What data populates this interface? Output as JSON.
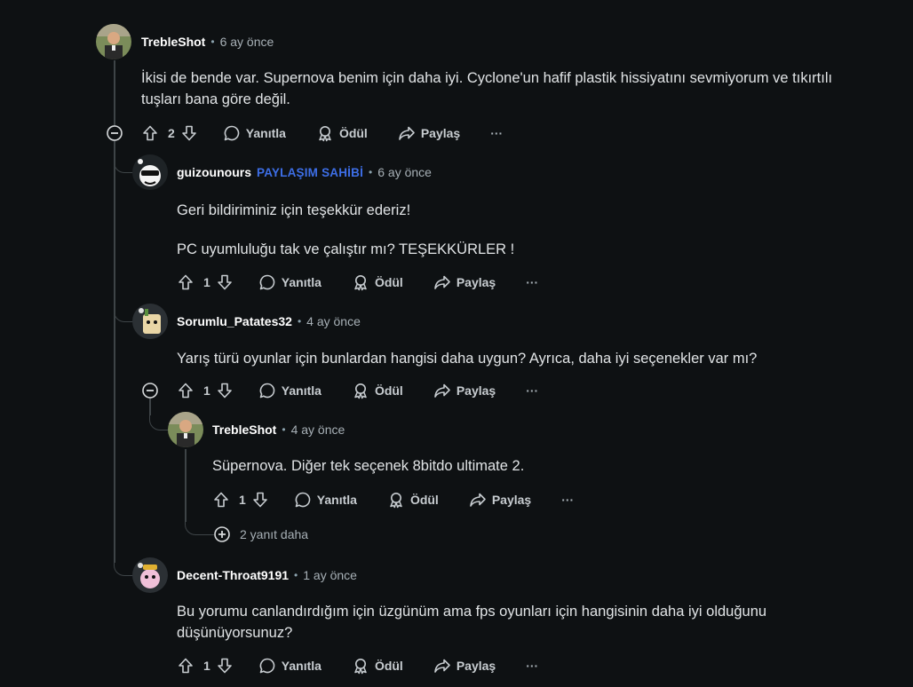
{
  "colors": {
    "background": "#0e1113",
    "op_badge": "#3d6ee6",
    "thread_line": "#3e4447",
    "text": "#e1e4e6"
  },
  "actions": {
    "reply": "Yanıtla",
    "award": "Ödül",
    "share": "Paylaş",
    "more": "···"
  },
  "comments": [
    {
      "user": "TrebleShot",
      "dot": "•",
      "time": "6 ay önce",
      "lines": [
        "İkisi de bende var. Supernova benim için daha iyi. Cyclone'un hafif plastik hissiyatını sevmiyorum ve tıkırtılı",
        "tuşları bana göre değil."
      ],
      "votes": "2"
    },
    {
      "user": "guizounours",
      "badge": "PAYLAŞIM SAHİBİ",
      "dot": "•",
      "time": "6 ay önce",
      "lines": [
        "Geri bildiriminiz için teşekkür ederiz!",
        "PC uyumluluğu tak ve çalıştır mı? TEŞEKKÜRLER !"
      ],
      "votes": "1"
    },
    {
      "user": "Sorumlu_Patates32",
      "dot": "•",
      "time": "4 ay önce",
      "lines": [
        "Yarış türü oyunlar için bunlardan hangisi daha uygun? Ayrıca, daha iyi seçenekler var mı?"
      ],
      "votes": "1"
    },
    {
      "user": "TrebleShot",
      "dot": "•",
      "time": "4 ay önce",
      "lines": [
        "Süpernova. Diğer tek seçenek 8bitdo ultimate 2."
      ],
      "votes": "1"
    },
    {
      "user": "Decent-Throat9191",
      "dot": "•",
      "time": "1 ay önce",
      "lines": [
        "Bu yorumu canlandırdığım için üzgünüm ama fps oyunları için hangisinin daha iyi olduğunu",
        "düşünüyorsunuz?"
      ],
      "votes": "1"
    }
  ],
  "more_replies": "2 yanıt daha",
  "icons": [
    "avatar-photo",
    "avatar-snoo",
    "upvote-icon",
    "downvote-icon",
    "comment-icon",
    "award-icon",
    "share-icon",
    "collapse-minus-icon",
    "expand-plus-icon"
  ]
}
